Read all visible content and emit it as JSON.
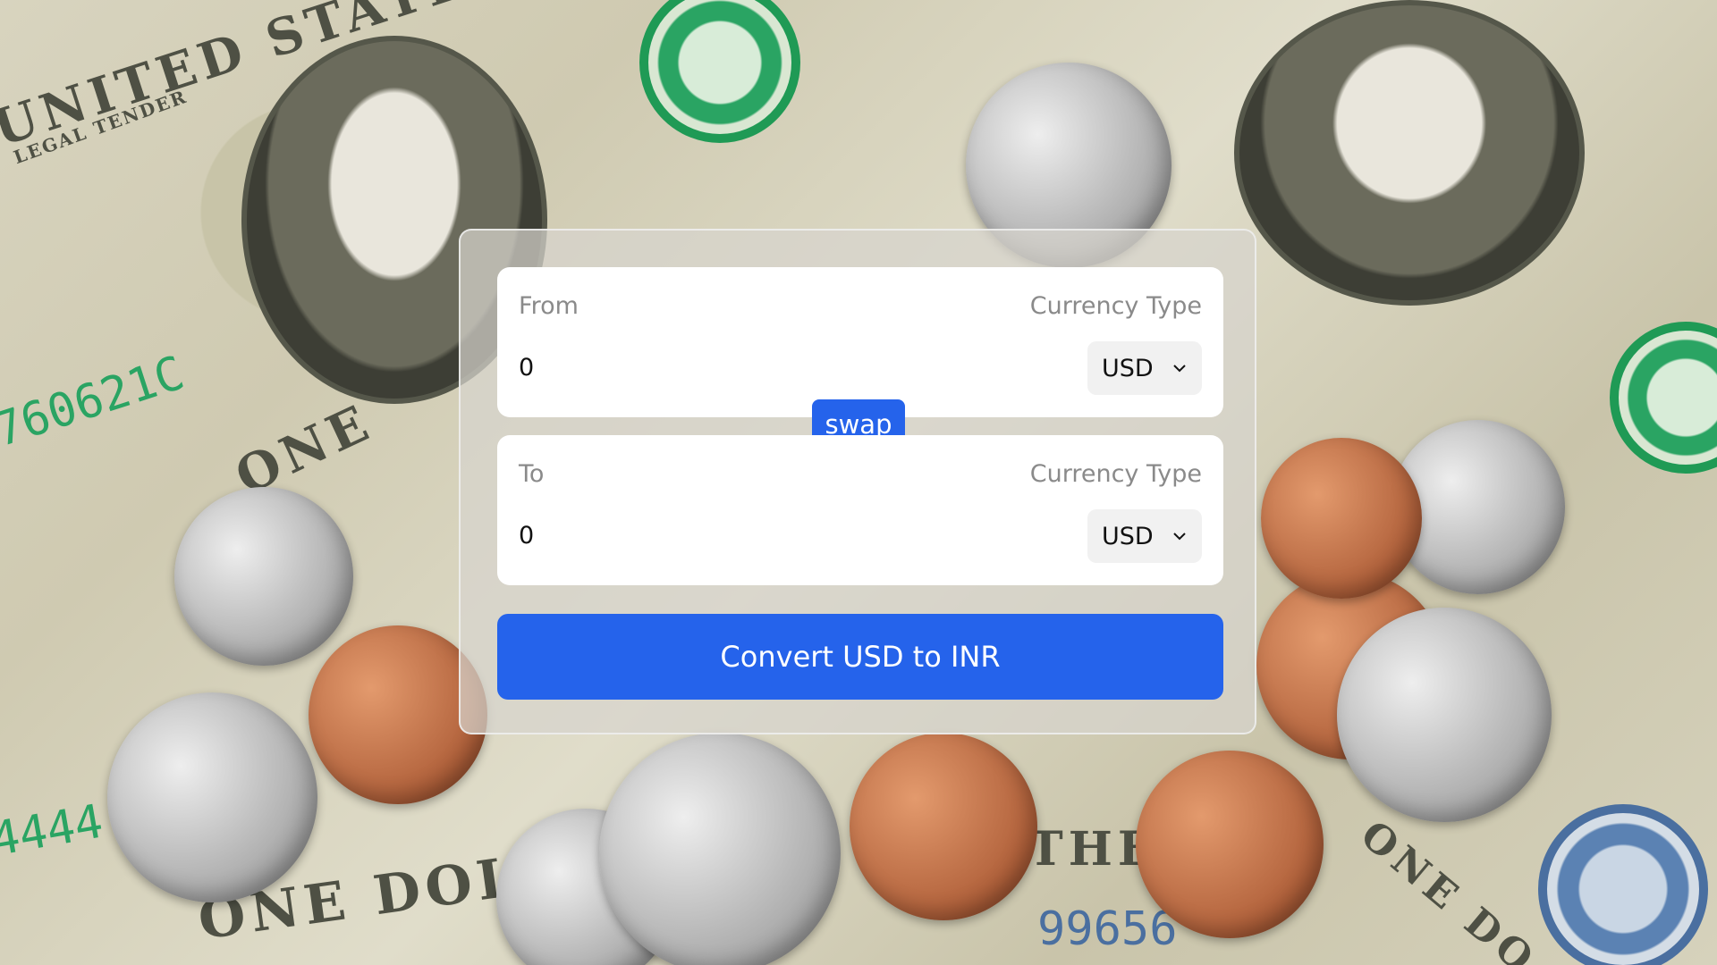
{
  "background": {
    "description_icon": "money-background-image",
    "colors": {
      "bill": "#d8d4bf",
      "seal": "#2aa463",
      "silver": "#a8a8a8",
      "copper": "#b0603a"
    },
    "bill_texts": [
      "UNITED STATES",
      "LEGAL TENDER",
      "ONE DOLLAR",
      "ONE",
      "ONE DO",
      "THE"
    ],
    "serials": [
      "760621C",
      "4444",
      "99656"
    ]
  },
  "converter": {
    "from": {
      "label": "From",
      "currency_type_label": "Currency Type",
      "amount": "0",
      "currency": "USD"
    },
    "to": {
      "label": "To",
      "currency_type_label": "Currency Type",
      "amount": "0",
      "currency": "USD"
    },
    "swap_label": "swap",
    "convert_label": "Convert USD to INR",
    "colors": {
      "accent": "#2563eb",
      "card": "#ffffff",
      "label": "#8a8a8a"
    },
    "icons": {
      "dropdown": "chevron-down-icon"
    }
  }
}
